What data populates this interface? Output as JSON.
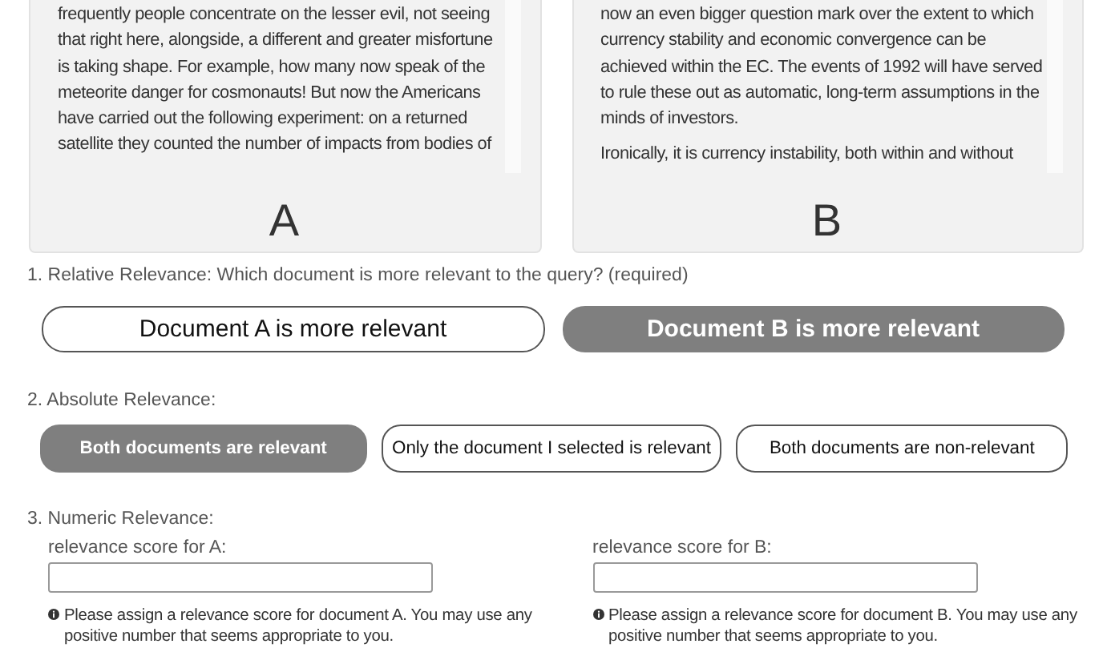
{
  "documents": [
    {
      "label": "A",
      "paragraphs": [
        "frequently people concentrate on the lesser evil, not seeing that right here, alongside, a different and greater misfortune is taking shape. For example, how many now speak of the meteorite danger for cosmonauts! But now the Americans have carried out the following experiment: on a returned satellite they counted the number of impacts from bodies of"
      ]
    },
    {
      "label": "B",
      "paragraphs": [
        "now an even bigger question mark over the extent to which currency stability and economic convergence can be achieved within the EC. The events of 1992 will have served to rule these out as automatic, long-term assumptions in the minds of investors.",
        "Ironically, it is currency instability, both within and without"
      ]
    }
  ],
  "relative": {
    "question": "1. Relative Relevance: Which document is more relevant to the query? (required)",
    "options": [
      {
        "label": "Document A is more relevant",
        "selected": false
      },
      {
        "label": "Document B is more relevant",
        "selected": true
      }
    ]
  },
  "absolute": {
    "question": "2. Absolute Relevance:",
    "options": [
      {
        "label": "Both documents are relevant",
        "selected": true
      },
      {
        "label": "Only the document I selected is relevant",
        "selected": false
      },
      {
        "label": "Both documents are non-relevant",
        "selected": false
      }
    ]
  },
  "numeric": {
    "question": "3. Numeric Relevance:",
    "fields": [
      {
        "label": "relevance score for A:",
        "hint": "Please assign a relevance score for document A. You may use any positive number that seems appropriate to you."
      },
      {
        "label": "relevance score for B:",
        "hint": "Please assign a relevance score for document B. You may use any positive number that seems appropriate to you."
      }
    ]
  }
}
